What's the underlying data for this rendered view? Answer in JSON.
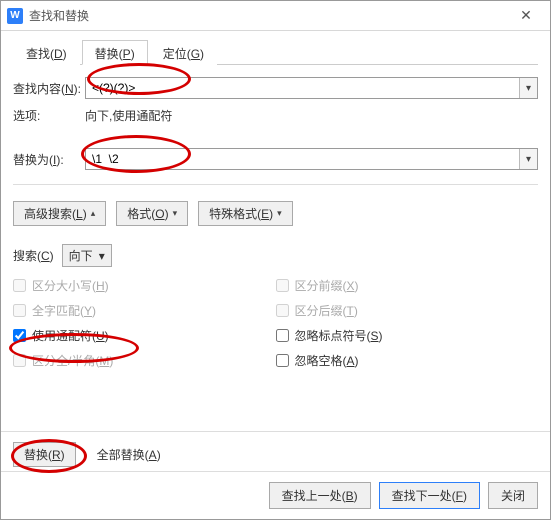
{
  "window": {
    "title": "查找和替换",
    "app_icon_letter": "W"
  },
  "tabs": {
    "find": "查找(",
    "find_mn": "D",
    "find_end": ")",
    "replace": "替换(",
    "replace_mn": "P",
    "replace_end": ")",
    "goto": "定位(",
    "goto_mn": "G",
    "goto_end": ")"
  },
  "fields": {
    "find_label_pre": "查找内容(",
    "find_label_mn": "N",
    "find_label_post": "):",
    "find_value": "<(?)(?)>",
    "options_label": "选项:",
    "options_value": "向下,使用通配符",
    "replace_label_pre": "替换为(",
    "replace_label_mn": "I",
    "replace_label_post": "):",
    "replace_value": "\\1  \\2"
  },
  "buttons": {
    "adv_search": "高级搜索(",
    "adv_search_mn": "L",
    "adv_search_end": ")",
    "format": "格式(",
    "format_mn": "O",
    "format_end": ")",
    "special": "特殊格式(",
    "special_mn": "E",
    "special_end": ")",
    "search_label": "搜索(",
    "search_mn": "C",
    "search_end": ")",
    "search_direction": "向下",
    "replace": "替换(",
    "replace_mn": "R",
    "replace_end": ")",
    "replace_all": "全部替换(",
    "replace_all_mn": "A",
    "replace_all_end": ")",
    "find_prev": "查找上一处(",
    "find_prev_mn": "B",
    "find_prev_end": ")",
    "find_next": "查找下一处(",
    "find_next_mn": "F",
    "find_next_end": ")",
    "close": "关闭"
  },
  "checks": {
    "match_case": "区分大小写(",
    "match_case_mn": "H",
    "match_case_end": ")",
    "whole_word": "全字匹配(",
    "whole_word_mn": "Y",
    "whole_word_end": ")",
    "wildcards": "使用通配符(",
    "wildcards_mn": "U",
    "wildcards_end": ")",
    "full_half": "区分全/半角(",
    "full_half_mn": "M",
    "full_half_end": ")",
    "prefix": "区分前缀(",
    "prefix_mn": "X",
    "prefix_end": ")",
    "suffix": "区分后缀(",
    "suffix_mn": "T",
    "suffix_end": ")",
    "ignore_punct": "忽略标点符号(",
    "ignore_punct_mn": "S",
    "ignore_punct_end": ")",
    "ignore_space": "忽略空格(",
    "ignore_space_mn": "A",
    "ignore_space_end": ")"
  },
  "annotation_color": "#d40000"
}
